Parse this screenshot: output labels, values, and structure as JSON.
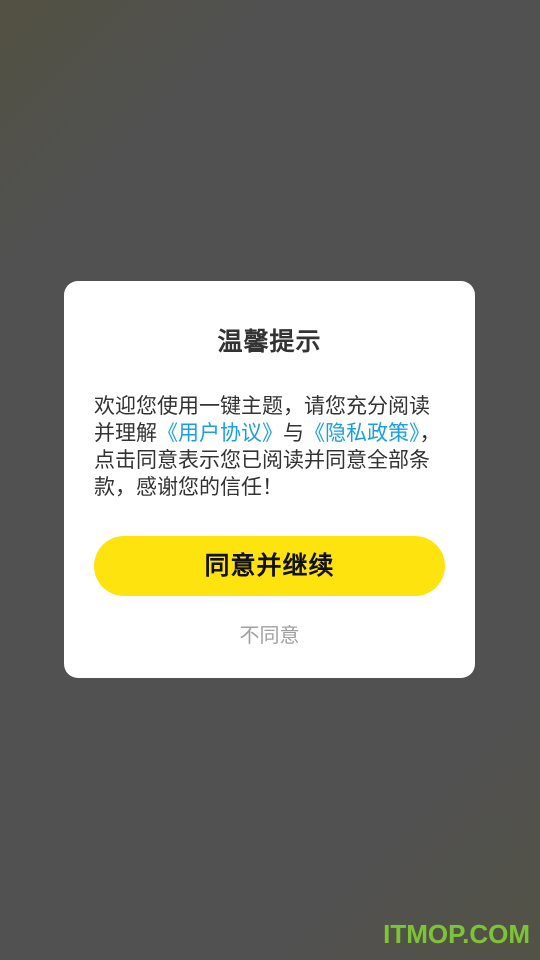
{
  "dialog": {
    "title": "温馨提示",
    "body": {
      "text_1": "欢迎您使用一键主题，请您充分阅读并理解",
      "user_agreement_link": "《用户协议》",
      "text_2": "与",
      "privacy_policy_link": "《隐私政策》",
      "text_3": "，点击同意表示您已阅读并同意全部条款，感谢您的信任！"
    },
    "agree_label": "同意并继续",
    "disagree_label": "不同意"
  },
  "watermark": {
    "text": "ITMOP.COM"
  },
  "colors": {
    "accent_yellow": "#ffe30f",
    "link_blue": "#1a9fe3",
    "overlay": "#515151"
  }
}
